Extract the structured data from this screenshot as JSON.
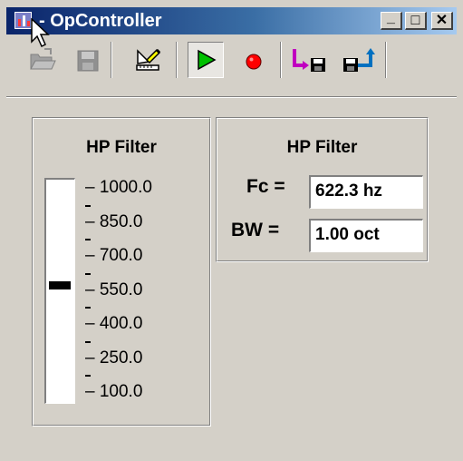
{
  "window": {
    "title": "- OpController",
    "caption_buttons": {
      "minimize": "_",
      "maximize": "□",
      "close": "✕"
    }
  },
  "toolbar": {
    "buttons": [
      {
        "icon": "open-folder-icon",
        "enabled": false
      },
      {
        "icon": "save-disk-icon",
        "enabled": false
      },
      {
        "icon": "edit-ruler-icon",
        "enabled": true
      },
      {
        "icon": "play-icon",
        "enabled": true,
        "pressed": true,
        "color": "#00c000"
      },
      {
        "icon": "record-icon",
        "enabled": true,
        "color": "#ff0000"
      },
      {
        "icon": "load-preset-icon",
        "enabled": true,
        "color": "#c000c0"
      },
      {
        "icon": "save-preset-icon",
        "enabled": true,
        "color": "#0070c0"
      }
    ]
  },
  "slider_panel": {
    "title": "HP Filter",
    "ticks": [
      "1000.0",
      "850.0",
      "700.0",
      "550.0",
      "400.0",
      "250.0",
      "100.0"
    ],
    "value_position": 0.47
  },
  "params_panel": {
    "title": "HP Filter",
    "fc_label": "Fc =",
    "fc_value": "622.3 hz",
    "bw_label": "BW =",
    "bw_value": "1.00 oct"
  }
}
